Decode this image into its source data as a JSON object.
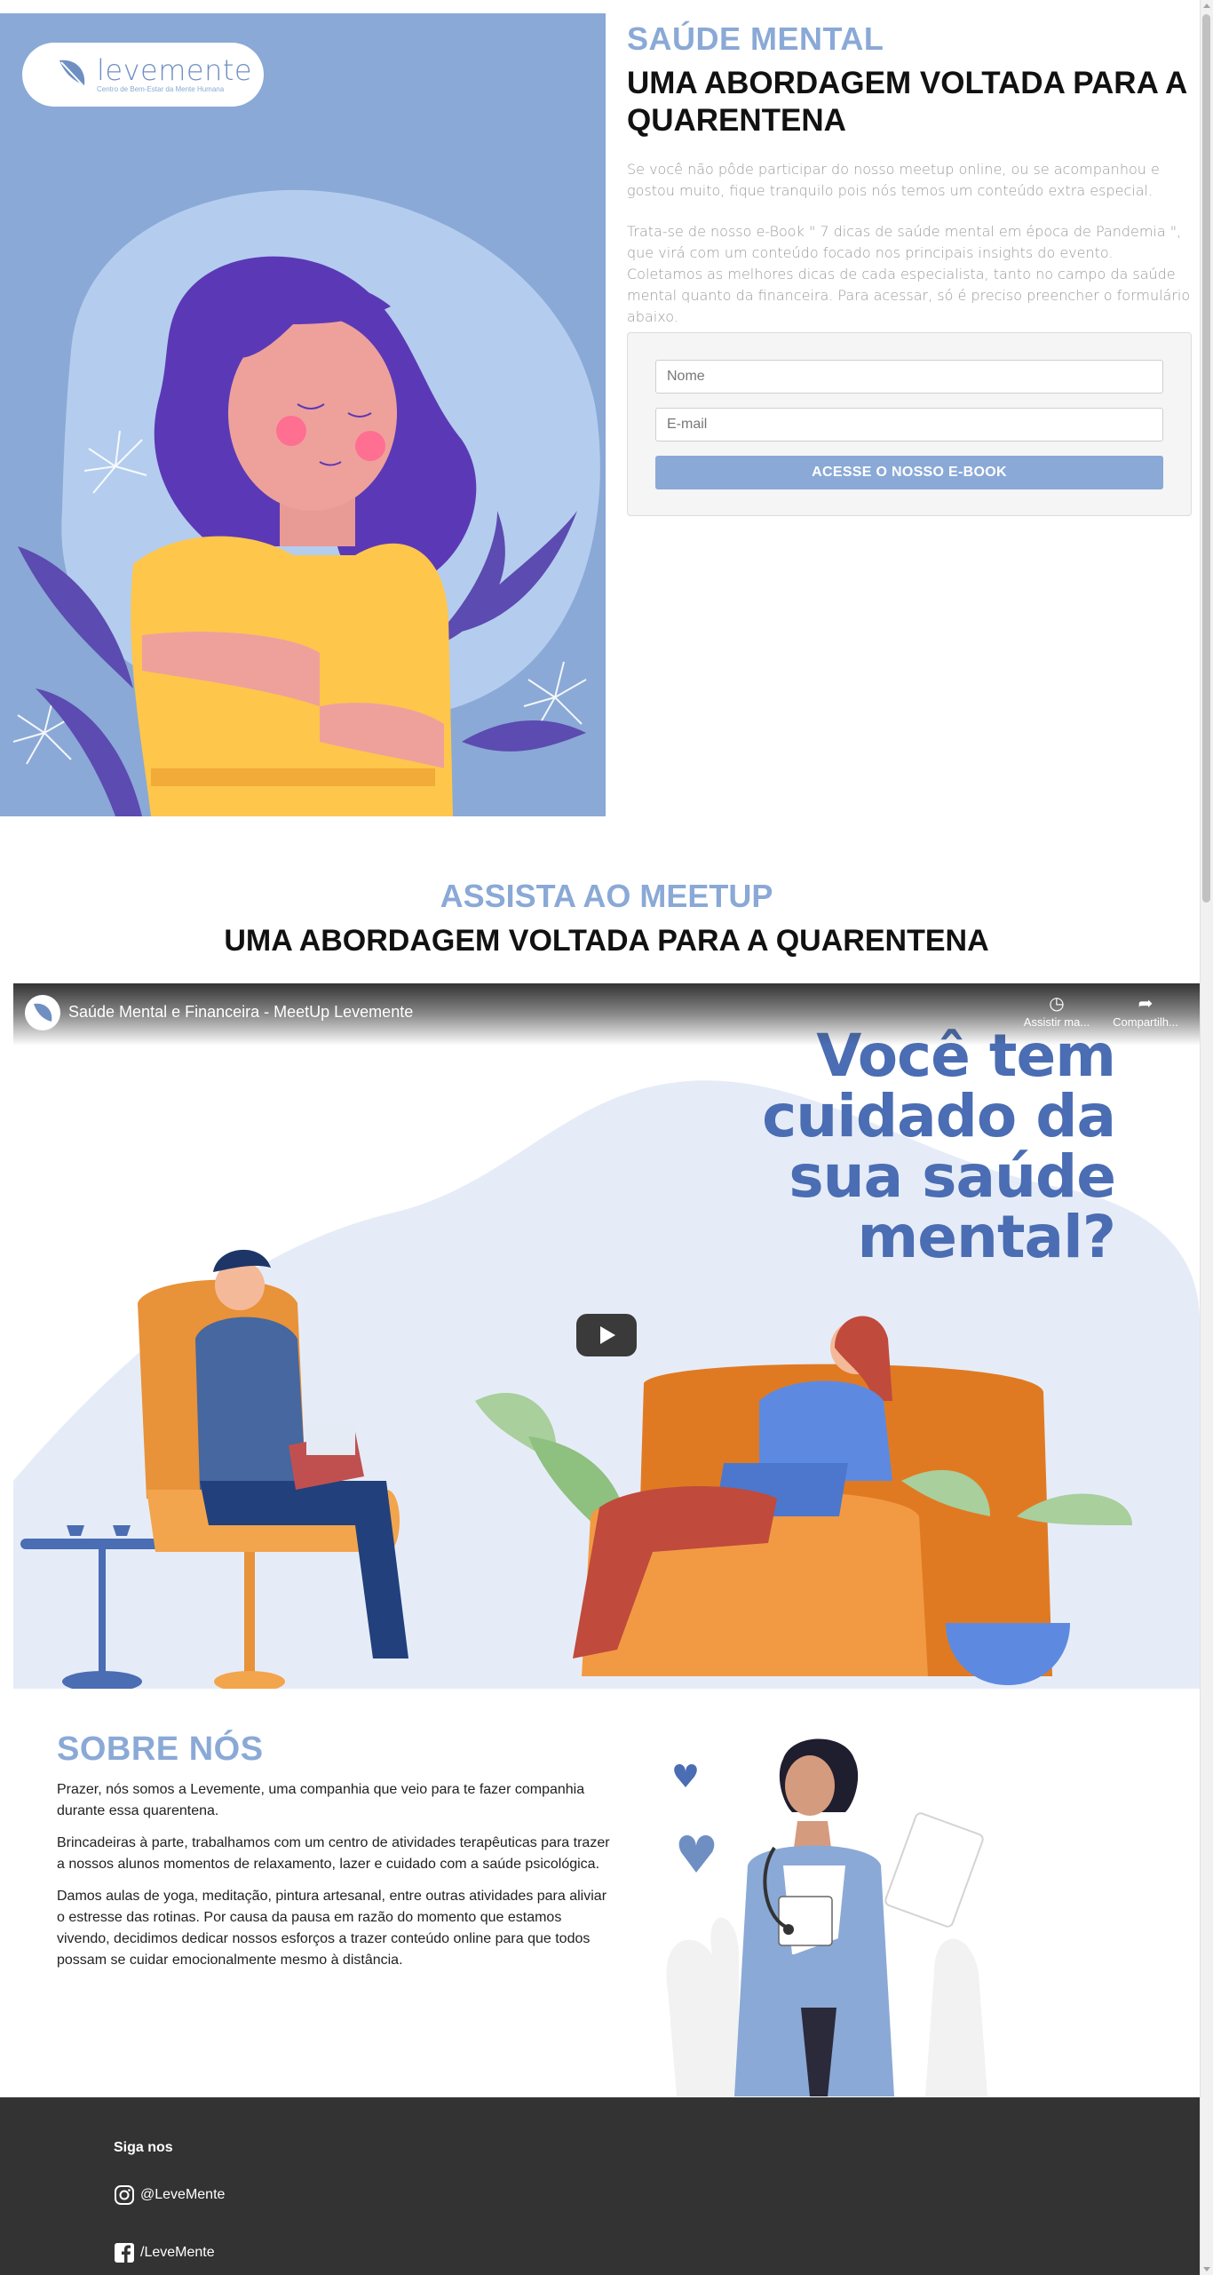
{
  "brand": {
    "logo_text": "levemente",
    "logo_tagline": "Centro de Bem-Estar da Mente Humana"
  },
  "hero": {
    "kicker": "SAÚDE MENTAL",
    "title": "UMA ABORDAGEM VOLTADA PARA A QUARENTENA",
    "paragraph_1": "Se você não pôde participar do nosso meetup online, ou se acompanhou e gostou muito, fique tranquilo pois nós temos um conteúdo extra especial.",
    "paragraph_2": "Trata-se de nosso e-Book \" 7 dicas de saúde mental em época de Pandemia \", que virá com um conteúdo focado nos principais insights do evento. Coletamos as melhores dicas de cada especialista, tanto no campo da saúde mental quanto da financeira. Para acessar, só é preciso preencher o formulário abaixo."
  },
  "form": {
    "name_placeholder": "Nome",
    "email_placeholder": "E-mail",
    "submit_label": "ACESSE O NOSSO E-BOOK"
  },
  "meetup": {
    "kicker": "ASSISTA AO MEETUP",
    "title": "UMA ABORDAGEM VOLTADA PARA A QUARENTENA"
  },
  "video": {
    "title": "Saúde Mental e Financeira - MeetUp Levemente",
    "watch_later_label": "Assistir ma...",
    "share_label": "Compartilh...",
    "headline": "Você tem\ncuidado da\nsua saúde\nmental?"
  },
  "about": {
    "title": "SOBRE NÓS",
    "paragraphs": [
      "Prazer, nós somos a Levemente, uma companhia que veio para te fazer companhia durante essa quarentena.",
      "Brincadeiras à parte, trabalhamos com um centro de atividades terapêuticas para trazer a nossos alunos momentos de relaxamento, lazer e cuidado com a saúde psicológica.",
      "Damos aulas de yoga, meditação, pintura artesanal, entre outras atividades para aliviar o estresse das rotinas. Por causa da pausa em razão do momento que estamos vivendo, decidimos dedicar nossos esforços a trazer conteúdo online para que todos possam se cuidar emocionalmente mesmo à distância."
    ]
  },
  "footer": {
    "title": "Siga nos",
    "instagram": "@LeveMente",
    "facebook": "/LeveMente"
  },
  "icons": {
    "instagram": "instagram-icon",
    "facebook": "facebook-icon",
    "watch_later": "clock-icon",
    "share": "share-icon",
    "play": "play-icon"
  },
  "colors": {
    "accent": "#8aa9d6",
    "headline_blue": "#4a6db3",
    "footer_bg": "#333333"
  }
}
